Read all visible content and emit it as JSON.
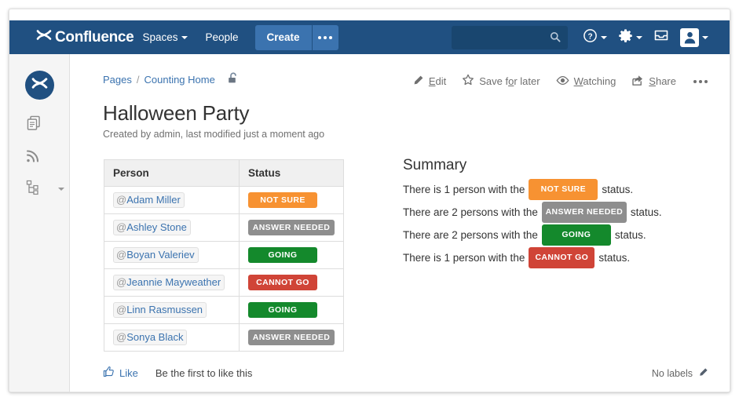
{
  "header": {
    "brand": "Confluence",
    "brand_icon": "confluence-logo-icon",
    "nav": [
      {
        "label": "Spaces",
        "has_caret": true
      },
      {
        "label": "People",
        "has_caret": false
      }
    ],
    "create_label": "Create",
    "create_more_icon": "ellipsis-icon",
    "search_placeholder": "",
    "search_value": "",
    "search_icon": "search-icon",
    "help_icon": "help-icon",
    "settings_icon": "gear-icon",
    "notifications_icon": "inbox-icon",
    "profile_icon": "user-avatar-icon",
    "bar_color": "#205081",
    "create_color": "#3b73af"
  },
  "sidebar": {
    "space_avatar_icon": "confluence-space-avatar-icon",
    "items": [
      {
        "icon": "pages-icon",
        "label": "Pages"
      },
      {
        "icon": "rss-blog-icon",
        "label": "Blog"
      },
      {
        "icon": "page-tree-icon",
        "label": "Page Tree"
      }
    ],
    "collapse_handle_icon": "drag-handle-icon"
  },
  "breadcrumb": {
    "items": [
      {
        "label": "Pages"
      },
      {
        "label": "Counting Home"
      }
    ],
    "separator": "/",
    "restrictions_icon": "open-padlock-icon"
  },
  "page": {
    "title": "Halloween Party",
    "meta": "Created by admin, last modified just a moment ago"
  },
  "actions": [
    {
      "icon": "pencil-icon",
      "pre": "",
      "accesskey": "E",
      "post": "dit"
    },
    {
      "icon": "star-icon",
      "pre": "Save f",
      "accesskey": "o",
      "post": "r later"
    },
    {
      "icon": "eye-icon",
      "pre": "",
      "accesskey": "W",
      "post": "atching"
    },
    {
      "icon": "share-icon",
      "pre": "",
      "accesskey": "S",
      "post": "hare"
    }
  ],
  "actions_more_icon": "ellipsis-icon",
  "table": {
    "columns": [
      "Person",
      "Status"
    ],
    "rows": [
      {
        "person": "Adam Miller",
        "status": "NOT SURE",
        "status_color": "orange"
      },
      {
        "person": "Ashley Stone",
        "status": "ANSWER NEEDED",
        "status_color": "grey"
      },
      {
        "person": "Boyan Valeriev",
        "status": "GOING",
        "status_color": "green"
      },
      {
        "person": "Jeannie Mayweather",
        "status": "CANNOT GO",
        "status_color": "red"
      },
      {
        "person": "Linn Rasmussen",
        "status": "GOING",
        "status_color": "green"
      },
      {
        "person": "Sonya Black",
        "status": "ANSWER NEEDED",
        "status_color": "grey"
      }
    ],
    "mention_prefix": "@"
  },
  "summary": {
    "heading": "Summary",
    "lines": [
      {
        "prefix": "There is 1 person with the",
        "badge": "NOT SURE",
        "color": "orange",
        "suffix": "status."
      },
      {
        "prefix": "There are 2 persons with the",
        "badge": "ANSWER NEEDED",
        "color": "grey",
        "suffix": "status."
      },
      {
        "prefix": "There are 2 persons with the",
        "badge": "GOING",
        "color": "green",
        "suffix": "status."
      },
      {
        "prefix": "There is 1 person with the",
        "badge": "CANNOT GO",
        "color": "red",
        "suffix": "status."
      }
    ]
  },
  "footer": {
    "like_label": "Like",
    "like_icon": "thumbs-up-icon",
    "like_note": "Be the first to like this",
    "labels_text": "No labels",
    "labels_edit_icon": "pencil-icon"
  },
  "colors": {
    "orange": "#f79232",
    "grey": "#8e8e8e",
    "green": "#14892c",
    "red": "#d04437",
    "link": "#3b73af"
  }
}
